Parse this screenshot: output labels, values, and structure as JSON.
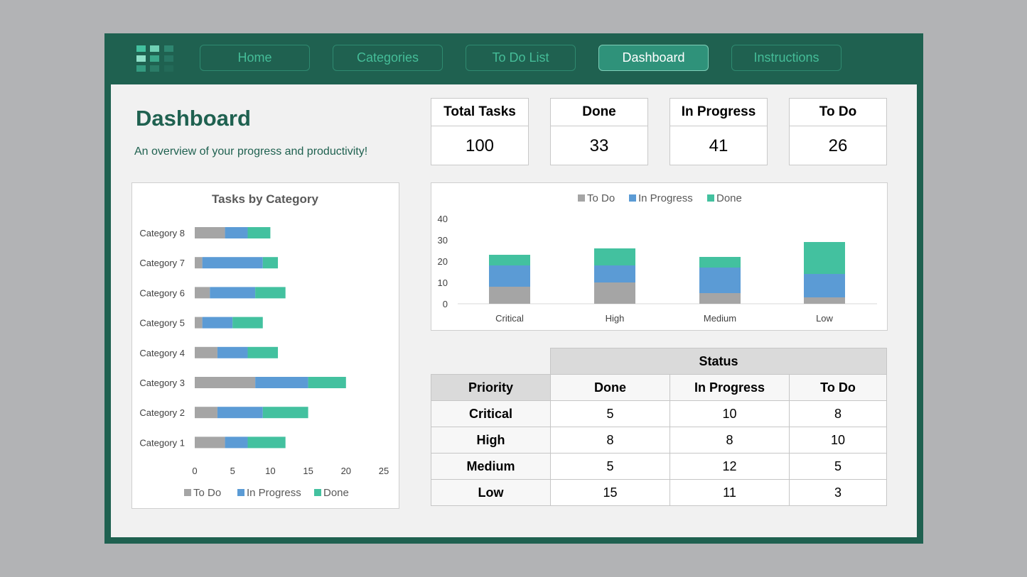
{
  "nav": {
    "items": [
      {
        "label": "Home",
        "active": false
      },
      {
        "label": "Categories",
        "active": false
      },
      {
        "label": "To Do List",
        "active": false
      },
      {
        "label": "Dashboard",
        "active": true
      },
      {
        "label": "Instructions",
        "active": false
      }
    ]
  },
  "header": {
    "title": "Dashboard",
    "subtitle": "An overview of your progress and productivity!"
  },
  "kpis": [
    {
      "label": "Total Tasks",
      "value": "100"
    },
    {
      "label": "Done",
      "value": "33"
    },
    {
      "label": "In Progress",
      "value": "41"
    },
    {
      "label": "To Do",
      "value": "26"
    }
  ],
  "colors": {
    "brand_dark": "#1f6150",
    "accent": "#45bd98",
    "todo": "#a5a5a5",
    "in_progress": "#5b9bd5",
    "done": "#43c19f"
  },
  "pivot": {
    "status_header": "Status",
    "row_header": "Priority",
    "columns": [
      "Done",
      "In Progress",
      "To Do"
    ],
    "rows": [
      {
        "label": "Critical",
        "values": [
          "5",
          "10",
          "8"
        ]
      },
      {
        "label": "High",
        "values": [
          "8",
          "8",
          "10"
        ]
      },
      {
        "label": "Medium",
        "values": [
          "5",
          "12",
          "5"
        ]
      },
      {
        "label": "Low",
        "values": [
          "15",
          "11",
          "3"
        ]
      }
    ]
  },
  "chart_data": [
    {
      "type": "bar",
      "orientation": "horizontal",
      "stacked": true,
      "title": "Tasks by Category",
      "categories": [
        "Category 1",
        "Category 2",
        "Category 3",
        "Category 4",
        "Category 5",
        "Category 6",
        "Category 7",
        "Category 8"
      ],
      "series": [
        {
          "name": "To Do",
          "values": [
            4,
            3,
            8,
            3,
            1,
            2,
            1,
            4
          ]
        },
        {
          "name": "In Progress",
          "values": [
            3,
            6,
            7,
            4,
            4,
            6,
            8,
            3
          ]
        },
        {
          "name": "Done",
          "values": [
            5,
            6,
            5,
            4,
            4,
            4,
            2,
            3
          ]
        }
      ],
      "xlim": [
        0,
        25
      ],
      "xticks": [
        "0",
        "5",
        "10",
        "15",
        "20",
        "25"
      ],
      "xlabel": "",
      "ylabel": "",
      "grid": false,
      "legend": "bottom"
    },
    {
      "type": "bar",
      "orientation": "vertical",
      "stacked": true,
      "title": "",
      "categories": [
        "Critical",
        "High",
        "Medium",
        "Low"
      ],
      "series": [
        {
          "name": "To Do",
          "values": [
            8,
            10,
            5,
            3
          ]
        },
        {
          "name": "In Progress",
          "values": [
            10,
            8,
            12,
            11
          ]
        },
        {
          "name": "Done",
          "values": [
            5,
            8,
            5,
            15
          ]
        }
      ],
      "ylim": [
        0,
        40
      ],
      "yticks": [
        "0",
        "10",
        "20",
        "30",
        "40"
      ],
      "xlabel": "",
      "ylabel": "",
      "grid": false,
      "legend": "top"
    }
  ]
}
